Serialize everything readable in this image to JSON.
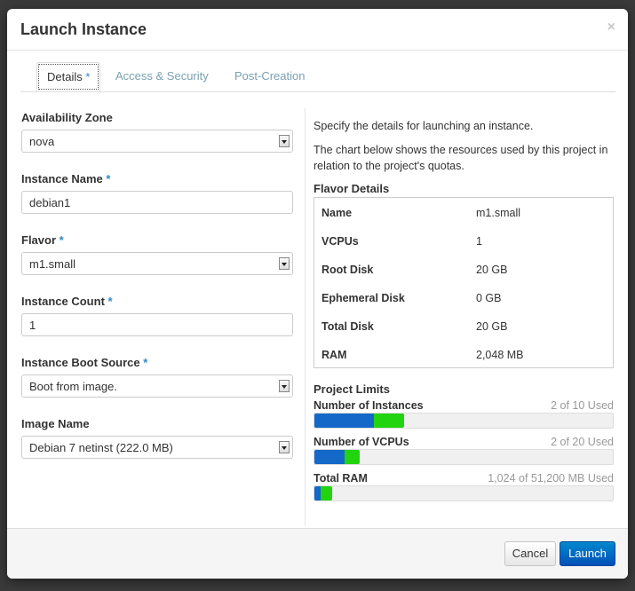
{
  "modal": {
    "title": "Launch Instance",
    "close": "×"
  },
  "tabs": [
    {
      "label": "Details",
      "required": "*"
    },
    {
      "label": "Access & Security"
    },
    {
      "label": "Post-Creation"
    }
  ],
  "form": {
    "availability_zone": {
      "label": "Availability Zone",
      "value": "nova"
    },
    "instance_name": {
      "label": "Instance Name",
      "required": "*",
      "value": "debian1"
    },
    "flavor": {
      "label": "Flavor",
      "required": "*",
      "value": "m1.small"
    },
    "instance_count": {
      "label": "Instance Count",
      "required": "*",
      "value": "1"
    },
    "boot_source": {
      "label": "Instance Boot Source",
      "required": "*",
      "value": "Boot from image."
    },
    "image_name": {
      "label": "Image Name",
      "value": "Debian 7 netinst (222.0 MB)"
    }
  },
  "help": {
    "line1": "Specify the details for launching an instance.",
    "line2": "The chart below shows the resources used by this project in relation to the project's quotas."
  },
  "flavor_details": {
    "heading": "Flavor Details",
    "rows": [
      {
        "key": "Name",
        "value": "m1.small"
      },
      {
        "key": "VCPUs",
        "value": "1"
      },
      {
        "key": "Root Disk",
        "value": "20 GB"
      },
      {
        "key": "Ephemeral Disk",
        "value": "0 GB"
      },
      {
        "key": "Total Disk",
        "value": "20 GB"
      },
      {
        "key": "RAM",
        "value": "2,048 MB"
      }
    ]
  },
  "project_limits": {
    "heading": "Project Limits",
    "items": [
      {
        "name": "Number of Instances",
        "used_text": "2 of 10 Used",
        "used_fraction": 0.2,
        "added_fraction": 0.1
      },
      {
        "name": "Number of VCPUs",
        "used_text": "2 of 20 Used",
        "used_fraction": 0.1,
        "added_fraction": 0.05
      },
      {
        "name": "Total RAM",
        "used_text": "1,024 of 51,200 MB Used",
        "used_fraction": 0.02,
        "added_fraction": 0.04
      }
    ]
  },
  "colors": {
    "used": "#1468c8",
    "added": "#21d40f",
    "launch": "#0066cc"
  },
  "footer": {
    "cancel": "Cancel",
    "launch": "Launch"
  }
}
